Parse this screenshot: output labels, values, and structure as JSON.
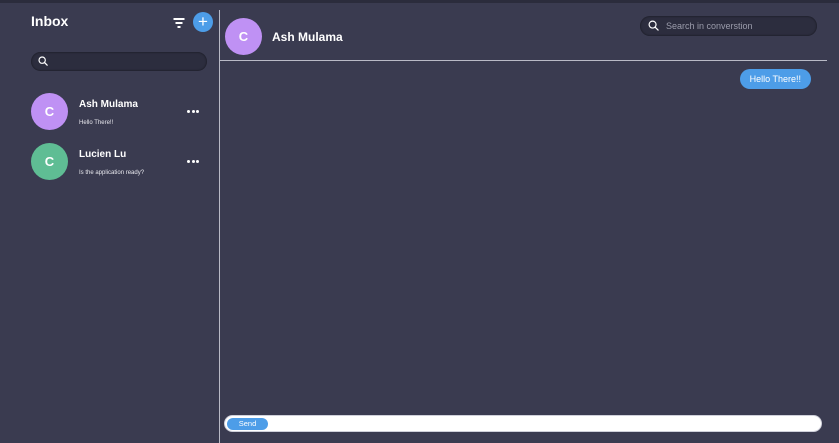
{
  "sidebar": {
    "title": "Inbox",
    "search": {
      "value": "",
      "placeholder": ""
    },
    "conversations": [
      {
        "initial": "C",
        "name": "Ash Mulama",
        "preview": "Hello There!!",
        "avatar_color": "#bf91f4"
      },
      {
        "initial": "C",
        "name": "Lucien Lu",
        "preview": "Is the application ready?",
        "avatar_color": "#5fbd94"
      }
    ]
  },
  "chat": {
    "contact_initial": "C",
    "contact_name": "Ash Mulama",
    "search": {
      "value": "",
      "placeholder": "Search in converstion"
    },
    "messages": [
      {
        "direction": "outgoing",
        "text": "Hello There!!"
      }
    ],
    "composer": {
      "value": "",
      "placeholder": "",
      "send_label": "Send"
    }
  },
  "colors": {
    "background": "#3a3b50",
    "accent": "#4d9de8",
    "field_bg": "#2c2d3e",
    "divider": "#b9bac6"
  },
  "icons": {
    "filter": "filter-icon",
    "add": "plus-icon",
    "search": "search-icon",
    "more": "more-horizontal-icon"
  }
}
